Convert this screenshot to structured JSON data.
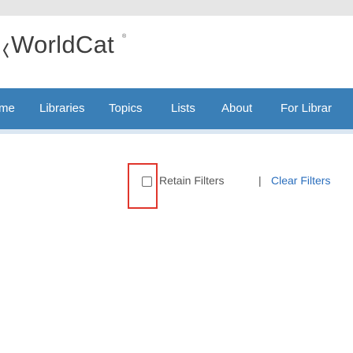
{
  "brand": {
    "name": "WorldCat",
    "tm": "®"
  },
  "nav": {
    "items": [
      {
        "label": "me"
      },
      {
        "label": "Libraries"
      },
      {
        "label": "Topics"
      },
      {
        "label": "Lists"
      },
      {
        "label": "About"
      },
      {
        "label": "For Librar"
      }
    ]
  },
  "filters": {
    "retain_label": "Retain Filters",
    "retain_checked": false,
    "separator": "|",
    "clear_label": "Clear Filters"
  },
  "colors": {
    "nav_bg": "#3a7fb7",
    "link": "#2a6ebd",
    "highlight": "#e0362c"
  }
}
